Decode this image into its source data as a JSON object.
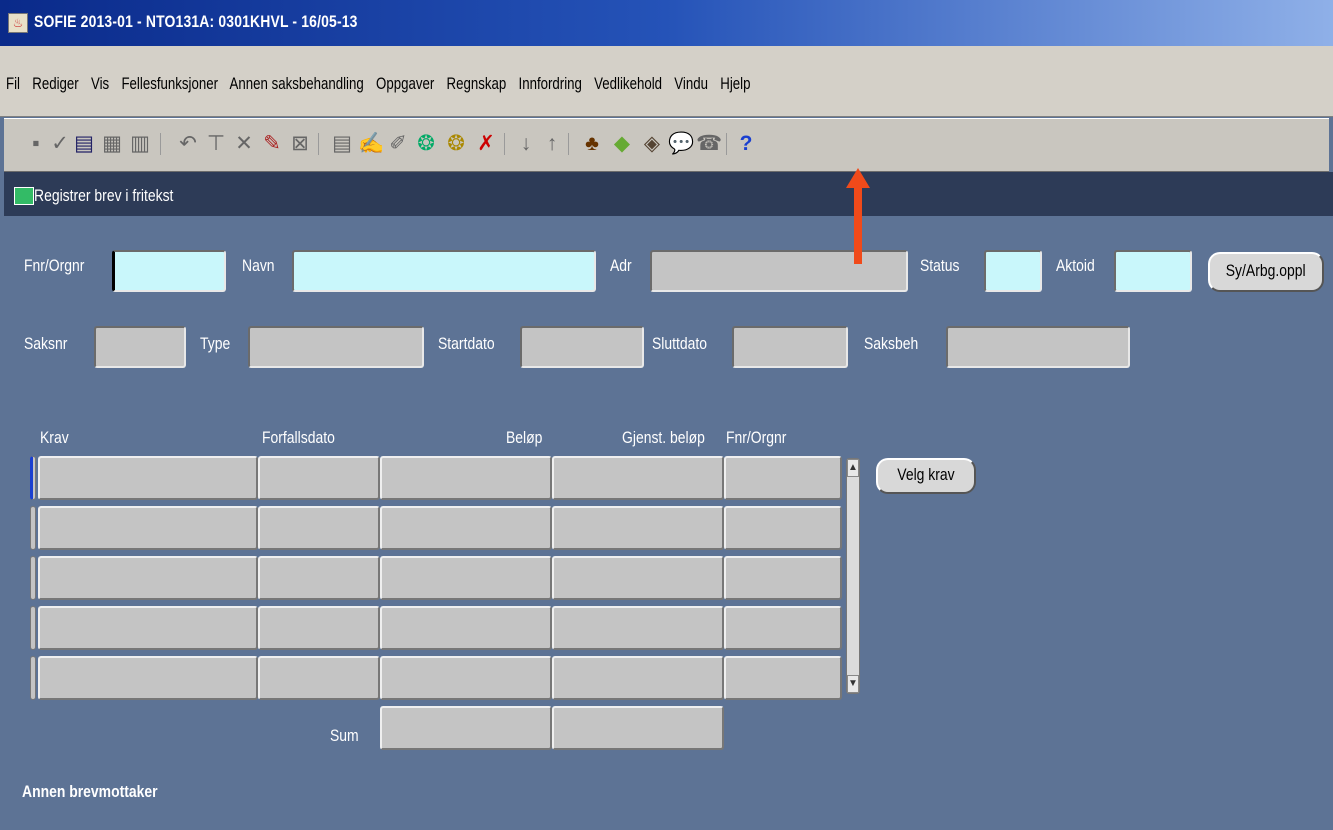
{
  "window": {
    "title": "SOFIE 2013-01  -  NTO131A: 0301KHVL  -  16/05-13"
  },
  "menu": [
    "Fil",
    "Rediger",
    "Vis",
    "Fellesfunksjoner",
    "Annen saksbehandling",
    "Oppgaver",
    "Regnskap",
    "Innfordring",
    "Vedlikehold",
    "Vindu",
    "Hjelp"
  ],
  "toolbar": {
    "help_glyph": "?"
  },
  "form": {
    "title": "Registrer brev i fritekst",
    "labels": {
      "fnr": "Fnr/Orgnr",
      "navn": "Navn",
      "adr": "Adr",
      "status": "Status",
      "aktoid": "Aktoid",
      "saksnr": "Saksnr",
      "type": "Type",
      "startdato": "Startdato",
      "sluttdato": "Sluttdato",
      "saksbeh": "Saksbeh"
    },
    "buttons": {
      "sy_arbg": "Sy/Arbg.oppl",
      "velg_krav": "Velg krav"
    }
  },
  "table": {
    "columns": [
      "Krav",
      "Forfallsdato",
      "Beløp",
      "Gjenst. beløp",
      "Fnr/Orgnr"
    ],
    "row_count": 5,
    "sum_label": "Sum"
  },
  "section": {
    "annen_brevmottaker": "Annen brevmottaker"
  },
  "colors": {
    "background": "#5d7395",
    "annotation_arrow": "#f04a1a",
    "input_highlight": "#c9f7fb"
  }
}
